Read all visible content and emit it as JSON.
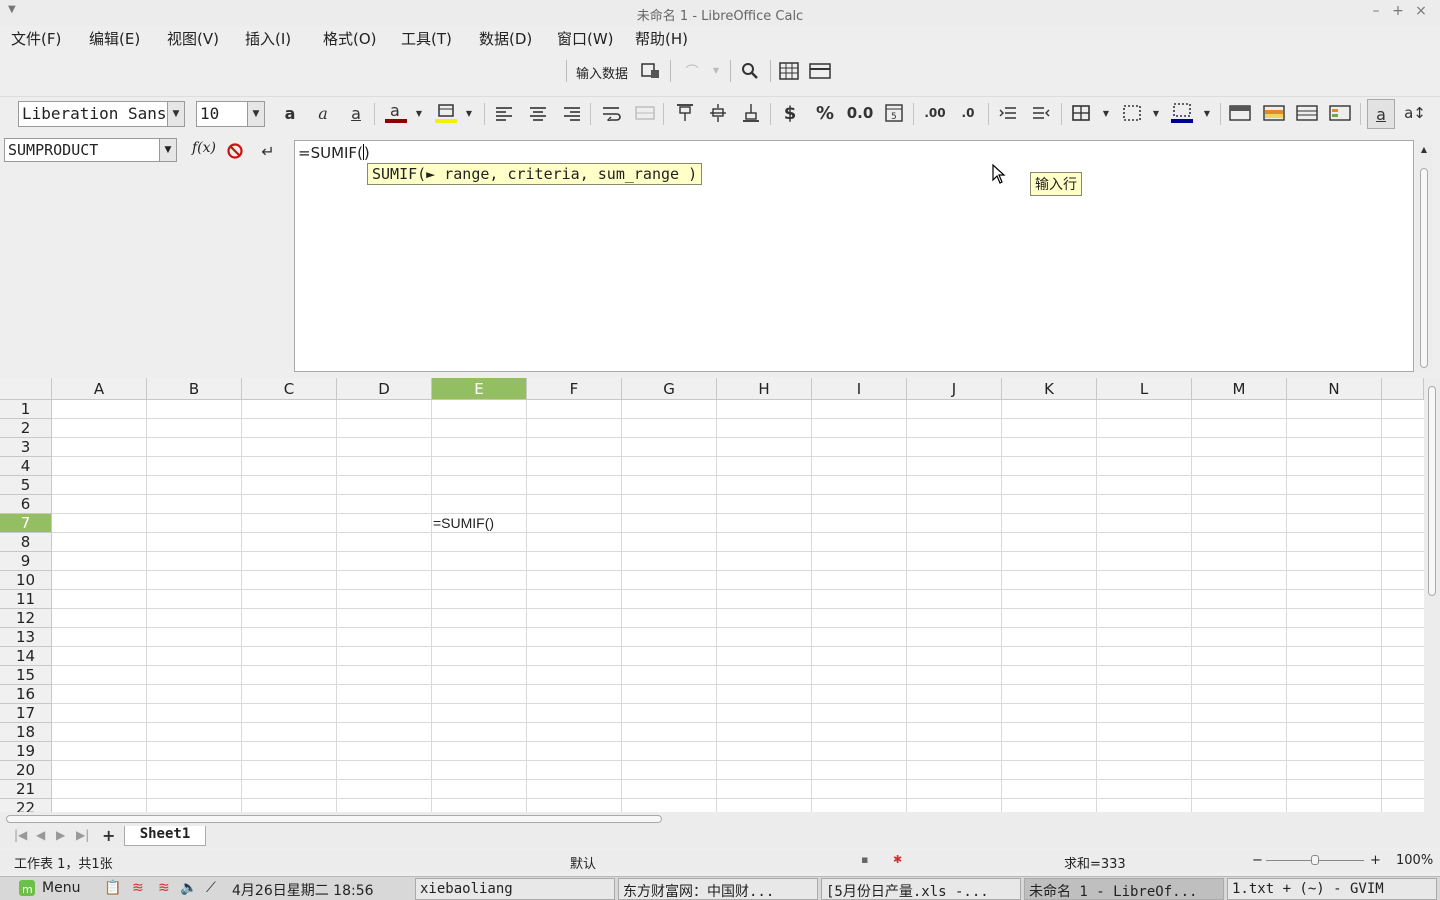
{
  "window": {
    "title": "未命名 1 - LibreOffice Calc"
  },
  "menu": {
    "items": [
      "文件(F)",
      "编辑(E)",
      "视图(V)",
      "插入(I)",
      "格式(O)",
      "工具(T)",
      "数据(D)",
      "窗口(W)",
      "帮助(H)"
    ]
  },
  "toolbar1": {
    "input_data_label": "输入数据"
  },
  "toolbar2": {
    "font_name": "Liberation Sans",
    "font_size": "10"
  },
  "formula": {
    "name_box": "SUMPRODUCT",
    "fx_label": "f(x)",
    "text": "=SUMIF(",
    "text_after_caret": ")",
    "hint": "SUMIF(► range, criteria, sum_range )",
    "input_line_tooltip": "输入行"
  },
  "grid": {
    "columns": [
      "A",
      "B",
      "C",
      "D",
      "E",
      "F",
      "G",
      "H",
      "I",
      "J",
      "K",
      "L",
      "M",
      "N"
    ],
    "selected_column": "E",
    "rows": [
      "1",
      "2",
      "3",
      "4",
      "5",
      "6",
      "7",
      "8",
      "9",
      "10",
      "11",
      "12",
      "13",
      "14",
      "15",
      "16",
      "17",
      "18",
      "19",
      "20",
      "21",
      "22"
    ],
    "selected_row": "7",
    "cell_e7": "=SUMIF()"
  },
  "sheets": {
    "tabs": [
      "Sheet1"
    ]
  },
  "status": {
    "sheet_info": "工作表 1，共1张",
    "page_style": "默认",
    "sum": "求和=333",
    "zoom": "100%"
  },
  "taskbar": {
    "menu_label": "Menu",
    "datetime": "4月26日星期二 18:56",
    "tasks": [
      "xiebaoliang",
      "东方财富网：中国财...",
      "[5月份日产量.xls -...",
      "未命名 1 - LibreOf...",
      "1.txt + (~) - GVIM"
    ]
  }
}
